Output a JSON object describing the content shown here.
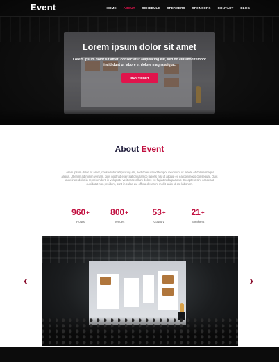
{
  "brand": {
    "logo": "Event",
    "accent_color": "#e0144c"
  },
  "nav": {
    "items": [
      {
        "label": "HOME",
        "active": false
      },
      {
        "label": "ABOUT",
        "active": true
      },
      {
        "label": "SCHEDULE",
        "active": false
      },
      {
        "label": "SPEAKERS",
        "active": false
      },
      {
        "label": "SPONSORS",
        "active": false
      },
      {
        "label": "CONTACT",
        "active": false
      },
      {
        "label": "BLOG",
        "active": false
      }
    ]
  },
  "hero": {
    "title": "Lorem ipsum dolor sit amet",
    "subtitle": "Lorem ipsum dolor sit amet, consectetur adipisicing elit, sed do eiusmod tempor incididunt ut labore et dolore magna aliqua.",
    "button_label": "BUY TICKET"
  },
  "about": {
    "title_prefix": "About",
    "title_accent": "Event",
    "text": "Lorem ipsum dolor sit amet, consectetur adipisicing elit, sed do eiusmod tempor incididunt ut labore et dolore magna aliqua. Ut enim ad minim veniam, quis nostrud exercitation ullamco laboris nisi ut aliquip ex ea commodo consequat. Duis aute irure dolor in reprehenderit in voluptate velit esse cillum dolore eu fugiat nulla pariatur. Excepteur sint occaecat cupidatat non proident, sunt in culpa qui officia deserunt mollit anim id est laborum."
  },
  "stats": [
    {
      "value": "960",
      "suffix": "+",
      "label": "Hours"
    },
    {
      "value": "800",
      "suffix": "+",
      "label": "Venues"
    },
    {
      "value": "53",
      "suffix": "+",
      "label": "Country"
    },
    {
      "value": "21",
      "suffix": "+",
      "label": "Speakers"
    }
  ],
  "carousel": {
    "prev_icon": "chevron-left-icon",
    "next_icon": "chevron-right-icon"
  }
}
